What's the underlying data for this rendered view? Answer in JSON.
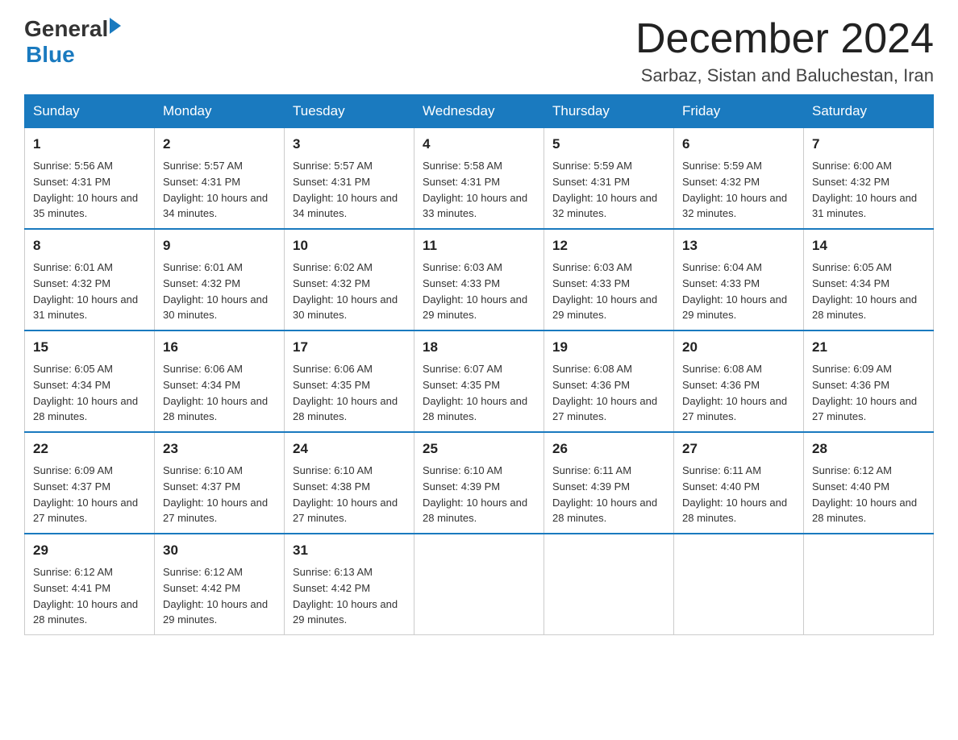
{
  "header": {
    "logo_general": "General",
    "logo_blue": "Blue",
    "main_title": "December 2024",
    "subtitle": "Sarbaz, Sistan and Baluchestan, Iran"
  },
  "days_of_week": [
    "Sunday",
    "Monday",
    "Tuesday",
    "Wednesday",
    "Thursday",
    "Friday",
    "Saturday"
  ],
  "weeks": [
    [
      {
        "day": "1",
        "sunrise": "5:56 AM",
        "sunset": "4:31 PM",
        "daylight": "10 hours and 35 minutes."
      },
      {
        "day": "2",
        "sunrise": "5:57 AM",
        "sunset": "4:31 PM",
        "daylight": "10 hours and 34 minutes."
      },
      {
        "day": "3",
        "sunrise": "5:57 AM",
        "sunset": "4:31 PM",
        "daylight": "10 hours and 34 minutes."
      },
      {
        "day": "4",
        "sunrise": "5:58 AM",
        "sunset": "4:31 PM",
        "daylight": "10 hours and 33 minutes."
      },
      {
        "day": "5",
        "sunrise": "5:59 AM",
        "sunset": "4:31 PM",
        "daylight": "10 hours and 32 minutes."
      },
      {
        "day": "6",
        "sunrise": "5:59 AM",
        "sunset": "4:32 PM",
        "daylight": "10 hours and 32 minutes."
      },
      {
        "day": "7",
        "sunrise": "6:00 AM",
        "sunset": "4:32 PM",
        "daylight": "10 hours and 31 minutes."
      }
    ],
    [
      {
        "day": "8",
        "sunrise": "6:01 AM",
        "sunset": "4:32 PM",
        "daylight": "10 hours and 31 minutes."
      },
      {
        "day": "9",
        "sunrise": "6:01 AM",
        "sunset": "4:32 PM",
        "daylight": "10 hours and 30 minutes."
      },
      {
        "day": "10",
        "sunrise": "6:02 AM",
        "sunset": "4:32 PM",
        "daylight": "10 hours and 30 minutes."
      },
      {
        "day": "11",
        "sunrise": "6:03 AM",
        "sunset": "4:33 PM",
        "daylight": "10 hours and 29 minutes."
      },
      {
        "day": "12",
        "sunrise": "6:03 AM",
        "sunset": "4:33 PM",
        "daylight": "10 hours and 29 minutes."
      },
      {
        "day": "13",
        "sunrise": "6:04 AM",
        "sunset": "4:33 PM",
        "daylight": "10 hours and 29 minutes."
      },
      {
        "day": "14",
        "sunrise": "6:05 AM",
        "sunset": "4:34 PM",
        "daylight": "10 hours and 28 minutes."
      }
    ],
    [
      {
        "day": "15",
        "sunrise": "6:05 AM",
        "sunset": "4:34 PM",
        "daylight": "10 hours and 28 minutes."
      },
      {
        "day": "16",
        "sunrise": "6:06 AM",
        "sunset": "4:34 PM",
        "daylight": "10 hours and 28 minutes."
      },
      {
        "day": "17",
        "sunrise": "6:06 AM",
        "sunset": "4:35 PM",
        "daylight": "10 hours and 28 minutes."
      },
      {
        "day": "18",
        "sunrise": "6:07 AM",
        "sunset": "4:35 PM",
        "daylight": "10 hours and 28 minutes."
      },
      {
        "day": "19",
        "sunrise": "6:08 AM",
        "sunset": "4:36 PM",
        "daylight": "10 hours and 27 minutes."
      },
      {
        "day": "20",
        "sunrise": "6:08 AM",
        "sunset": "4:36 PM",
        "daylight": "10 hours and 27 minutes."
      },
      {
        "day": "21",
        "sunrise": "6:09 AM",
        "sunset": "4:36 PM",
        "daylight": "10 hours and 27 minutes."
      }
    ],
    [
      {
        "day": "22",
        "sunrise": "6:09 AM",
        "sunset": "4:37 PM",
        "daylight": "10 hours and 27 minutes."
      },
      {
        "day": "23",
        "sunrise": "6:10 AM",
        "sunset": "4:37 PM",
        "daylight": "10 hours and 27 minutes."
      },
      {
        "day": "24",
        "sunrise": "6:10 AM",
        "sunset": "4:38 PM",
        "daylight": "10 hours and 27 minutes."
      },
      {
        "day": "25",
        "sunrise": "6:10 AM",
        "sunset": "4:39 PM",
        "daylight": "10 hours and 28 minutes."
      },
      {
        "day": "26",
        "sunrise": "6:11 AM",
        "sunset": "4:39 PM",
        "daylight": "10 hours and 28 minutes."
      },
      {
        "day": "27",
        "sunrise": "6:11 AM",
        "sunset": "4:40 PM",
        "daylight": "10 hours and 28 minutes."
      },
      {
        "day": "28",
        "sunrise": "6:12 AM",
        "sunset": "4:40 PM",
        "daylight": "10 hours and 28 minutes."
      }
    ],
    [
      {
        "day": "29",
        "sunrise": "6:12 AM",
        "sunset": "4:41 PM",
        "daylight": "10 hours and 28 minutes."
      },
      {
        "day": "30",
        "sunrise": "6:12 AM",
        "sunset": "4:42 PM",
        "daylight": "10 hours and 29 minutes."
      },
      {
        "day": "31",
        "sunrise": "6:13 AM",
        "sunset": "4:42 PM",
        "daylight": "10 hours and 29 minutes."
      },
      null,
      null,
      null,
      null
    ]
  ]
}
